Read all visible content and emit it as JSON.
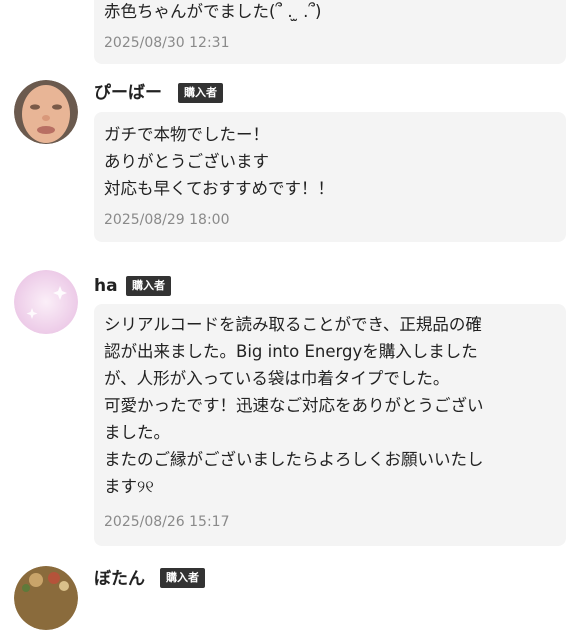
{
  "reviews": [
    {
      "username": "",
      "badge": "",
      "message": "赤色ちゃんがでました(՞ . ̫ .՞)",
      "timestamp": "2025/08/30 12:31"
    },
    {
      "username": "ぴーばー",
      "badge": "購入者",
      "message": "ガチで本物でしたー！\nありがとうございます\n対応も早くておすすめです！！",
      "timestamp": "2025/08/29 18:00"
    },
    {
      "username": "ha",
      "badge": "購入者",
      "message": "シリアルコードを読み取ることができ、正規品の確\n認が出来ました。Big into Energyを購入しました\nが、人形が入っている袋は巾着タイプでした。\n可愛かったです！迅速なご対応をありがとうござい\nました。\nまたのご縁がございましたらよろしくお願いいたし\nます୨୧",
      "timestamp": "2025/08/26 15:17"
    },
    {
      "username": "ぼたん",
      "badge": "購入者",
      "message": "",
      "timestamp": ""
    }
  ]
}
